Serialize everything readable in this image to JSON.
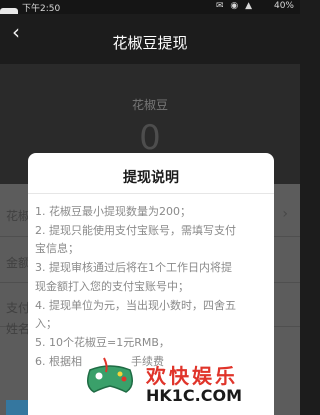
{
  "status_bar": {
    "time": "下午2:50",
    "battery": "40%"
  },
  "header": {
    "title": "花椒豆提现"
  },
  "balance": {
    "label": "花椒豆",
    "value": "0"
  },
  "form": {
    "row1_label": "花椒",
    "row2_label": "金额",
    "row3_label": "支付",
    "row4_label": "姓名"
  },
  "dialog": {
    "title": "提现说明",
    "lines": [
      "1. 花椒豆最小提现数量为200；",
      "2. 提现只能使用支付宝账号，需填写支付",
      "宝信息；",
      "3. 提现审核通过后将在1个工作日内将提",
      "现金额打入您的支付宝账号中；",
      "4. 提现单位为元，当出现小数时，四舍五",
      "入；",
      "5. 10个花椒豆=1元RMB，",
      "6. 根据相              手续费"
    ]
  },
  "watermark": {
    "text_cn": "欢快娱乐",
    "url": "HK1C.COM"
  }
}
